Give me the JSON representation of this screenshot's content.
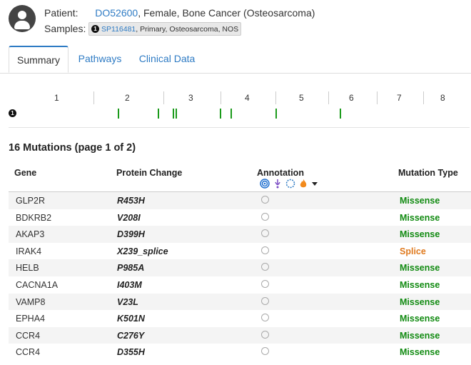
{
  "patient": {
    "label": "Patient:",
    "id": "DO52600",
    "details": ", Female, Bone Cancer (Osteosarcoma)"
  },
  "samples": {
    "label": "Samples:",
    "index": "1",
    "sample_id": "SP116481",
    "sample_details": ", Primary, Osteosarcoma, NOS"
  },
  "tabs": [
    {
      "label": "Summary",
      "active": true
    },
    {
      "label": "Pathways",
      "active": false
    },
    {
      "label": "Clinical Data",
      "active": false
    }
  ],
  "genome_track": {
    "sample_index": "1",
    "chromosomes": [
      "1",
      "2",
      "3",
      "4",
      "5",
      "6",
      "7",
      "8"
    ],
    "mutation_color": "#1a9a1a"
  },
  "mutations_heading": "16 Mutations (page 1 of 2)",
  "table": {
    "columns": {
      "gene": "Gene",
      "protein_change": "Protein Change",
      "annotation": "Annotation",
      "mutation_type": "Mutation Type"
    },
    "annotation_icons": [
      "oncokb-icon",
      "civic-icon",
      "my-cancer-genome-icon",
      "hotspot-fire-icon",
      "caret-down-icon"
    ],
    "rows": [
      {
        "gene": "GLP2R",
        "protein_change": "R453H",
        "mutation_type": "Missense",
        "type_color": "#108a10"
      },
      {
        "gene": "BDKRB2",
        "protein_change": "V208I",
        "mutation_type": "Missense",
        "type_color": "#108a10"
      },
      {
        "gene": "AKAP3",
        "protein_change": "D399H",
        "mutation_type": "Missense",
        "type_color": "#108a10"
      },
      {
        "gene": "IRAK4",
        "protein_change": "X239_splice",
        "mutation_type": "Splice",
        "type_color": "#e07b20"
      },
      {
        "gene": "HELB",
        "protein_change": "P985A",
        "mutation_type": "Missense",
        "type_color": "#108a10"
      },
      {
        "gene": "CACNA1A",
        "protein_change": "I403M",
        "mutation_type": "Missense",
        "type_color": "#108a10"
      },
      {
        "gene": "VAMP8",
        "protein_change": "V23L",
        "mutation_type": "Missense",
        "type_color": "#108a10"
      },
      {
        "gene": "EPHA4",
        "protein_change": "K501N",
        "mutation_type": "Missense",
        "type_color": "#108a10"
      },
      {
        "gene": "CCR4",
        "protein_change": "C276Y",
        "mutation_type": "Missense",
        "type_color": "#108a10"
      },
      {
        "gene": "CCR4",
        "protein_change": "D355H",
        "mutation_type": "Missense",
        "type_color": "#108a10"
      }
    ]
  }
}
